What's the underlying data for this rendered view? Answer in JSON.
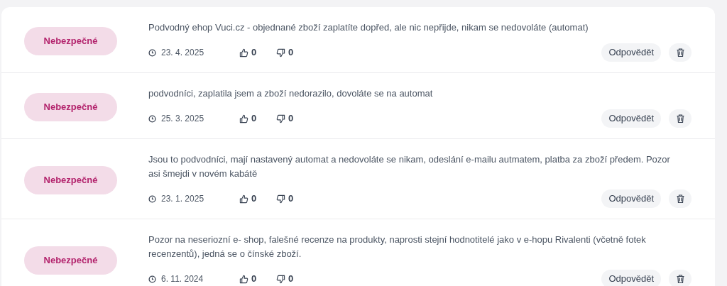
{
  "reviews": [
    {
      "badge": "Nebezpečné",
      "text": "Podvodný ehop Vuci.cz - objednané zboží zaplatíte dopřed, ale nic nepřijde, nikam se nedovoláte (automat)",
      "date": "23. 4. 2025",
      "likes": "0",
      "dislikes": "0",
      "reply": "Odpovědět"
    },
    {
      "badge": "Nebezpečné",
      "text": "podvodníci, zaplatila jsem a zboží nedorazilo, dovoláte se na automat",
      "date": "25. 3. 2025",
      "likes": "0",
      "dislikes": "0",
      "reply": "Odpovědět"
    },
    {
      "badge": "Nebezpečné",
      "text": "Jsou to podvodníci, mají nastavený automat a nedovoláte se nikam, odeslání e-mailu autmatem, platba za zboží předem. Pozor asi šmejdi v novém kabátě",
      "date": "23. 1. 2025",
      "likes": "0",
      "dislikes": "0",
      "reply": "Odpovědět"
    },
    {
      "badge": "Nebezpečné",
      "text": "Pozor na neseriozní e- shop, falešné recenze na produkty, naprosti stejní hodnotitelé jako v e-hopu Rivalenti (včetně fotek recenzentů), jedná se o čínské zboží.",
      "date": "6. 11. 2024",
      "likes": "0",
      "dislikes": "0",
      "reply": "Odpovědět"
    }
  ]
}
